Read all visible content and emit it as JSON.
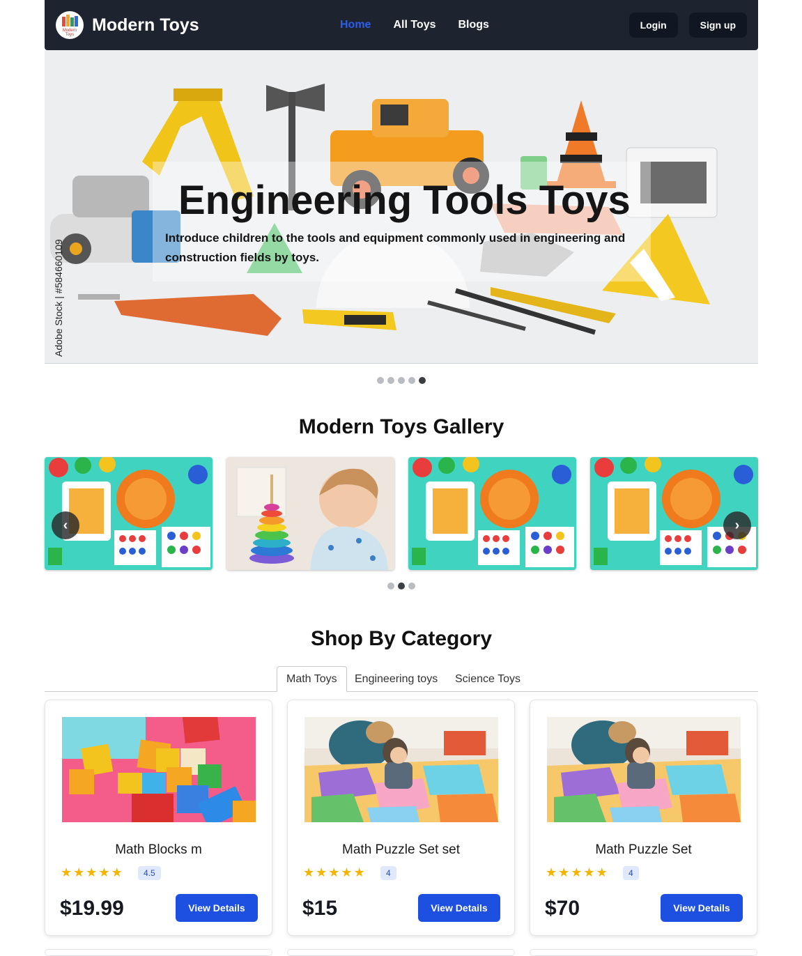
{
  "nav": {
    "brand": "Modern Toys",
    "logo_text": "Modern Toys",
    "links": [
      {
        "label": "Home",
        "active": true
      },
      {
        "label": "All Toys",
        "active": false
      },
      {
        "label": "Blogs",
        "active": false
      }
    ],
    "login_label": "Login",
    "signup_label": "Sign up"
  },
  "hero": {
    "title": "Engineering Tools Toys",
    "description": "Introduce children to the tools and equipment commonly used in engineering and construction fields by toys.",
    "watermark": "Adobe Stock | #584660109",
    "slide_count": 5,
    "active_slide": 5
  },
  "gallery": {
    "heading": "Modern Toys Gallery",
    "prev_icon": "chevron-left-icon",
    "next_icon": "chevron-right-icon",
    "page_count": 3,
    "active_page": 2
  },
  "categories": {
    "heading": "Shop By Category",
    "tabs": [
      {
        "label": "Math Toys",
        "active": true
      },
      {
        "label": "Engineering toys",
        "active": false
      },
      {
        "label": "Science Toys",
        "active": false
      }
    ]
  },
  "products": [
    {
      "name": "Math Blocks m",
      "rating": "4.5",
      "stars": 5,
      "price": "$19.99",
      "button": "View Details"
    },
    {
      "name": "Math Puzzle Set set",
      "rating": "4",
      "stars": 5,
      "price": "$15",
      "button": "View Details"
    },
    {
      "name": "Math Puzzle Set",
      "rating": "4",
      "stars": 5,
      "price": "$70",
      "button": "View Details"
    }
  ],
  "colors": {
    "nav_bg": "#1e2330",
    "active_link": "#2d5ee8",
    "primary_button": "#1d50e0",
    "star": "#f4b400"
  }
}
